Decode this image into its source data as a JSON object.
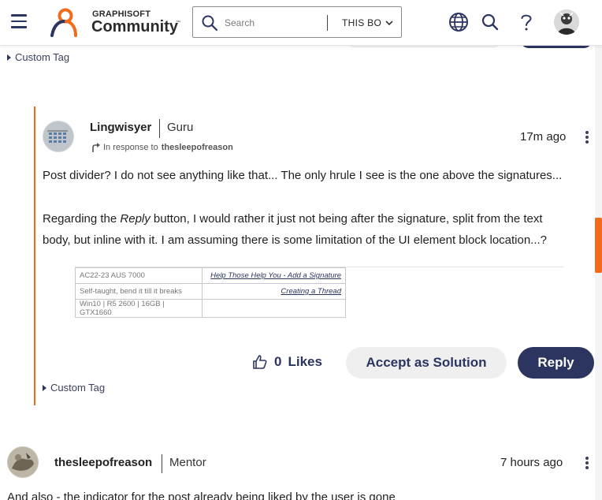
{
  "header": {
    "brand_top": "GRAPHISOFT",
    "brand_bottom": "Community",
    "brand_tm": "™",
    "search_placeholder": "Search",
    "search_scope": "THIS BO",
    "icons": [
      "menu-icon",
      "globe-icon",
      "search-icon",
      "help-icon",
      "avatar"
    ]
  },
  "colors": {
    "accent_orange": "#f26a1b",
    "navy": "#2c3560",
    "light_button": "#efefef"
  },
  "top_tag": {
    "label": "Custom Tag"
  },
  "reply_post": {
    "author": "Lingwisyer",
    "rank": "Guru",
    "in_response_prefix": "In response to",
    "in_response_to": "thesleepofreason",
    "time": "17m ago",
    "paragraph1": "Post divider? I do not see anything like that... The only hrule I see is the one above the signatures...",
    "paragraph2_before": "Regarding the ",
    "paragraph2_em": "Reply",
    "paragraph2_after_line1": " button, I would rather it just not being after the signature, split from the text",
    "paragraph2_line2": "body, but inline with it. I am assuming there is some limitation of the UI element block location...?",
    "signature": {
      "rows": [
        {
          "left": "AC22-23 AUS 7000",
          "right": "Help Those Help You - Add a Signature"
        },
        {
          "left": "Self-taught, bend it till it breaks",
          "right": "Creating a Thread"
        },
        {
          "left": "Win10 | R5 2600 | 16GB | GTX1660",
          "right": ""
        }
      ]
    },
    "likes_count": "0",
    "likes_label": "Likes",
    "accept_label": "Accept as Solution",
    "reply_label": "Reply",
    "tag_label": "Custom Tag"
  },
  "next_post": {
    "author": "thesleepofreason",
    "rank": "Mentor",
    "time": "7 hours ago",
    "text": "And also - the indicator for the post already being liked by the user is gone"
  }
}
